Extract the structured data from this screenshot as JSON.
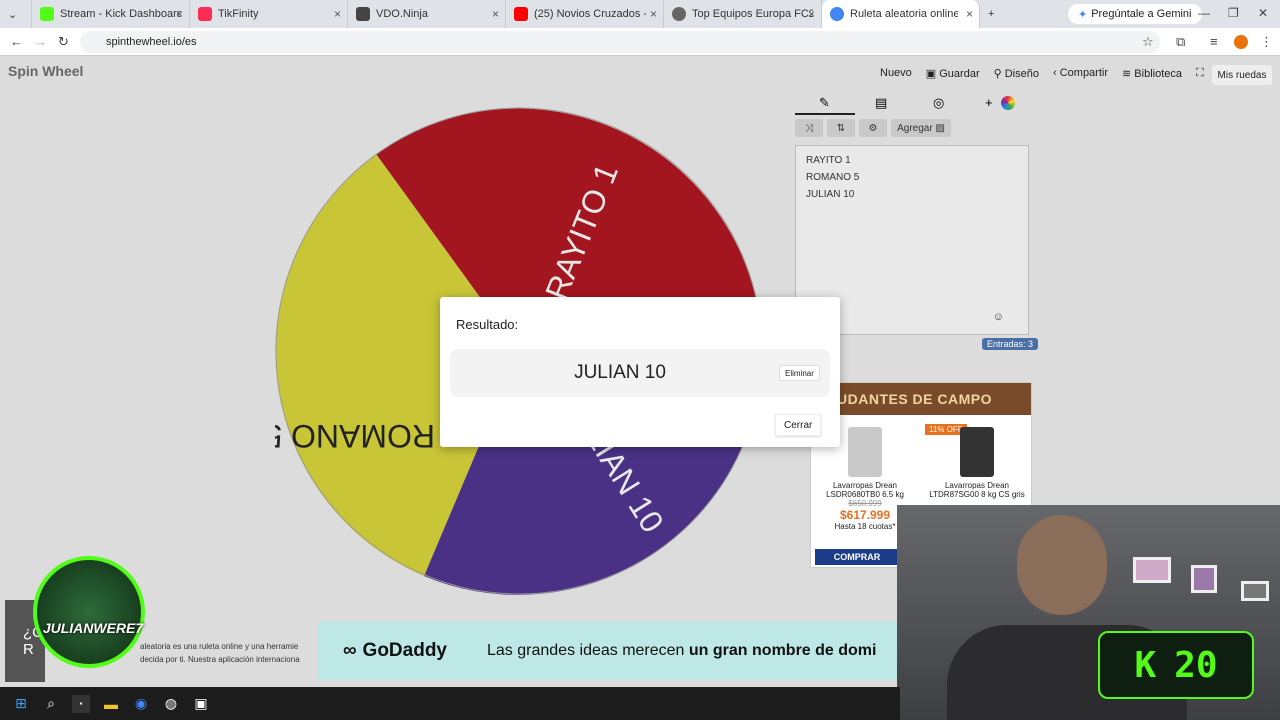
{
  "browser": {
    "tabs": [
      {
        "title": "Stream - Kick Dashboard",
        "color": "#53fc18"
      },
      {
        "title": "TikFinity",
        "color": "#fe2c55"
      },
      {
        "title": "VDO.Ninja",
        "color": "#444444"
      },
      {
        "title": "(25) Novios Cruzados - You",
        "color": "#ff0000"
      },
      {
        "title": "Top Equipos Europa FC25",
        "color": "#666666"
      },
      {
        "title": "Ruleta aleatoria online – ruleta",
        "color": "#4285f4"
      }
    ],
    "gemini": "Pregúntale a Gemini",
    "url": "spinthewheel.io/es"
  },
  "site": {
    "logo": "Spin Wheel",
    "menu": [
      "Nuevo",
      "Guardar",
      "Diseño",
      "Compartir",
      "Biblioteca"
    ],
    "mis_ruedas": "Mis ruedas",
    "agregar": "Agregar",
    "entries": [
      "RAYITO 1",
      "ROMANO 5",
      "JULIAN 10"
    ],
    "entries_count": "Entradas: 3"
  },
  "wheel": {
    "segments": [
      {
        "label": "RAYITO 1",
        "color": "#a3151f"
      },
      {
        "label": "JULIAN 10",
        "color": "#4a3185"
      },
      {
        "label": "ROMANO 5",
        "color": "#c8c537"
      }
    ],
    "visible_label_parts": [
      "RAYITO 1",
      "LIAN 10",
      "ROMANO 5"
    ]
  },
  "modal": {
    "title": "Resultado:",
    "result": "JULIAN 10",
    "delete": "Eliminar",
    "close": "Cerrar"
  },
  "ad_right": {
    "header": "UDANTES DE CAMPO",
    "p1_name": "Lavarropas Drean LSDR0680TB0 6.5 kg",
    "p1_old": "$650.999",
    "p1_price": "$617.999",
    "p1_quotas": "Hasta 18 cuotas*",
    "p2_disc": "11% OFF",
    "p2_name": "Lavarropas Drean LTDR87SG00 8 kg CS gris",
    "buy": "COMPRAR"
  },
  "ad_bottom": {
    "brand": "GoDaddy",
    "text_normal": "Las grandes ideas merecen ",
    "text_bold": "un gran nombre de domi"
  },
  "page_desc": "aleatoria es una ruleta online y una herramie decida por ti. Nuestra aplicación internaciona",
  "overlay": {
    "streamer": "JULIANWERE7",
    "k_letter": "K",
    "k_number": "20",
    "partial_text": "¿C R"
  }
}
